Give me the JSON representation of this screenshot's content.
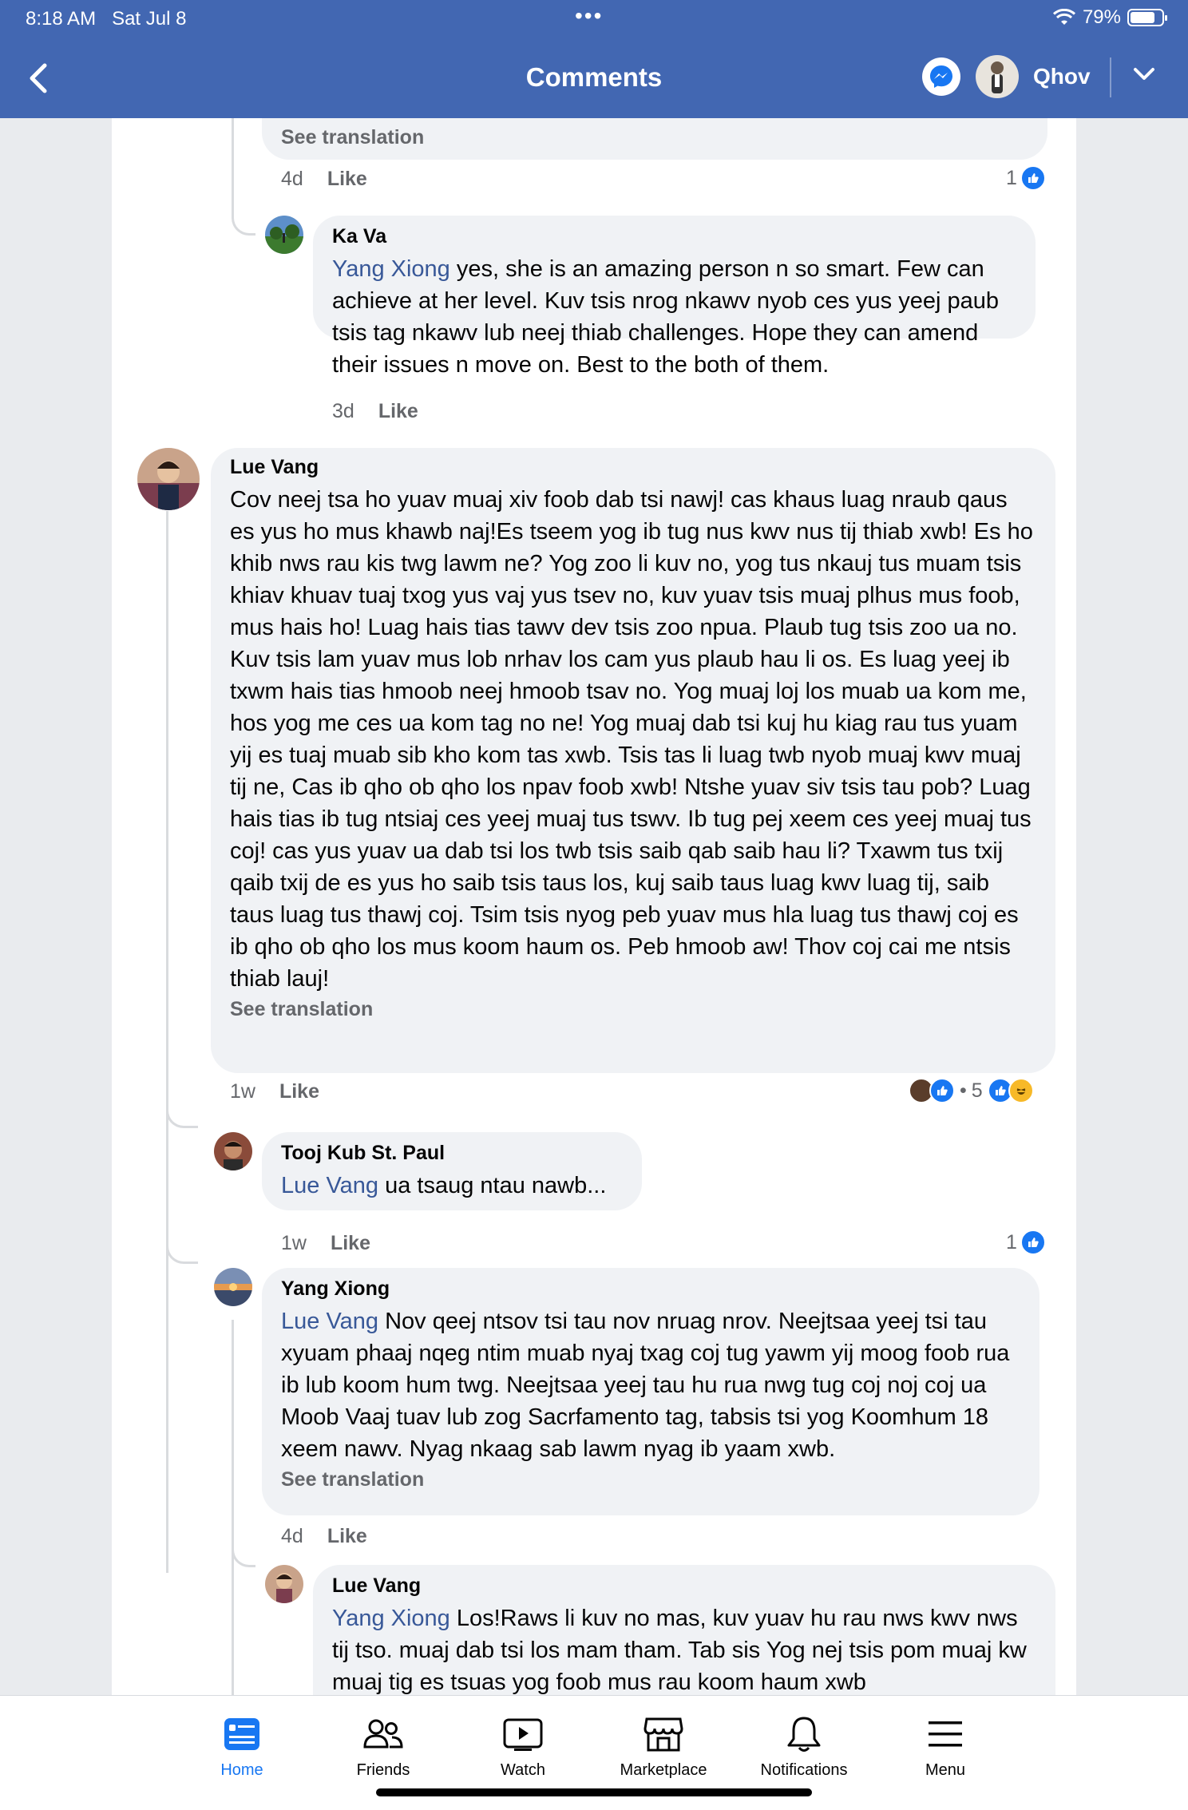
{
  "status_bar": {
    "time": "8:18 AM",
    "date": "Sat Jul 8",
    "battery": "79%",
    "battery_level": 0.79
  },
  "header": {
    "title": "Comments",
    "profile_name": "Qhov"
  },
  "comments": {
    "top_snippet": {
      "see_translation": "See translation",
      "time": "4d",
      "like": "Like",
      "reaction_count": "1"
    },
    "ka_va": {
      "author": "Ka Va",
      "mention": "Yang Xiong",
      "text": " yes, she is an amazing person n so smart. Few can achieve at her level. Kuv tsis nrog nkawv nyob ces yus yeej paub tsis tag nkawv lub neej thiab challenges. Hope they can amend their issues n move on. Best to the both of them.",
      "time": "3d",
      "like": "Like"
    },
    "lue_vang": {
      "author": "Lue Vang",
      "text": "Cov neej tsa ho yuav muaj xiv foob dab tsi nawj! cas khaus luag nraub qaus es yus ho mus khawb naj!Es tseem yog ib tug nus kwv nus tij thiab xwb! Es ho khib nws rau kis twg lawm ne? Yog zoo li kuv no, yog tus nkauj tus muam tsis khiav khuav tuaj txog yus vaj yus tsev no, kuv yuav tsis muaj plhus mus foob, mus hais ho! Luag hais tias tawv dev tsis zoo npua. Plaub tug tsis zoo ua no. Kuv tsis lam yuav mus lob nrhav los cam yus plaub hau li os. Es luag yeej ib txwm hais tias hmoob neej hmoob tsav no. Yog muaj loj los muab ua kom me, hos yog me ces ua kom tag no ne! Yog muaj dab tsi kuj hu kiag rau tus yuam yij es tuaj muab sib kho kom tas xwb. Tsis tas li luag twb nyob muaj kwv muaj tij ne, Cas ib qho ob qho los npav foob xwb! Ntshe yuav siv tsis tau pob? Luag hais tias ib tug ntsiaj ces yeej muaj tus tswv. Ib tug pej xeem ces yeej muaj tus coj! cas yus yuav ua dab tsi los twb tsis saib qab saib hau li? Txawm tus txij qaib txij de es yus ho saib tsis taus los, kuj saib taus luag kwv luag tij, saib taus luag tus thawj coj. Tsim tsis nyog peb yuav mus hla luag tus thawj coj es ib qho ob qho los mus koom haum os. Peb hmoob aw! Thov coj cai me ntsis thiab lauj!",
      "see_translation": "See translation",
      "time": "1w",
      "like": "Like",
      "reaction_count": "5",
      "reaction_sep": "•"
    },
    "tooj_kub": {
      "author": "Tooj Kub St. Paul",
      "mention": "Lue Vang",
      "text": " ua tsaug ntau nawb...",
      "time": "1w",
      "like": "Like",
      "reaction_count": "1"
    },
    "yang_xiong": {
      "author": "Yang Xiong",
      "mention": "Lue Vang",
      "text": " Nov qeej ntsov tsi tau nov nruag  nrov.  Neejtsaa yeej tsi tau xyuam phaaj nqeg ntim muab nyaj txag coj tug yawm yij moog foob rua ib lub koom hum twg.  Neejtsaa yeej tau hu rua nwg tug coj noj coj ua Moob Vaaj tuav lub zog Sacrfamento tag, tabsis tsi yog Koomhum 18 xeem nawv.   Nyag nkaag sab lawm nyag ib yaam xwb.",
      "see_translation": "See translation",
      "time": "4d",
      "like": "Like"
    },
    "lue_vang_reply": {
      "author": "Lue Vang",
      "mention": "Yang Xiong",
      "text": " Los!Raws li kuv no mas, kuv yuav hu rau nws kwv nws tij tso. muaj dab tsi los mam tham. Tab sis Yog nej tsis pom muaj kw muaj tig  es tsuas yog foob mus rau koom haum xwb"
    }
  },
  "tabbar": {
    "home": "Home",
    "friends": "Friends",
    "watch": "Watch",
    "marketplace": "Marketplace",
    "notifications": "Notifications",
    "menu": "Menu"
  },
  "colors": {
    "header": "#4267b2",
    "accent": "#1877f2",
    "mention": "#385898",
    "bubble": "#f0f2f5"
  }
}
